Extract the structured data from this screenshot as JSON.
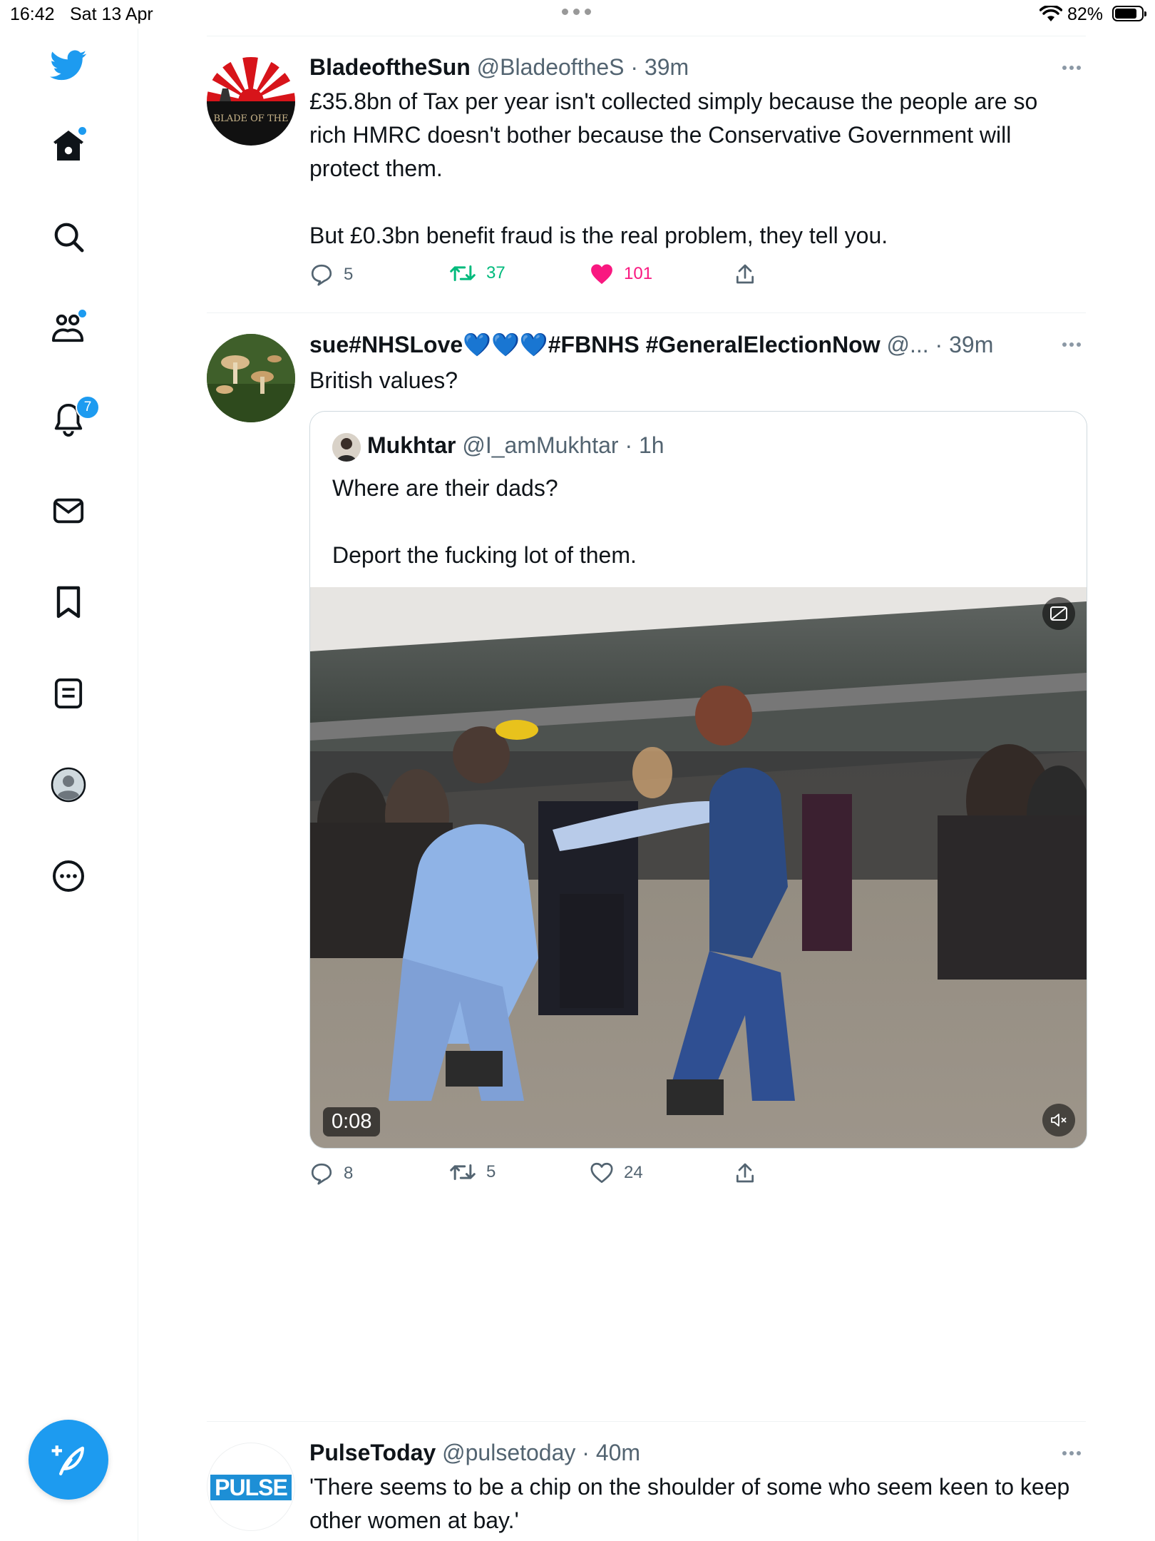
{
  "status_bar": {
    "time": "16:42",
    "date": "Sat 13 Apr",
    "battery": "82%"
  },
  "nav": {
    "items": [
      {
        "name": "home",
        "icon": "home-icon"
      },
      {
        "name": "explore",
        "icon": "search-icon"
      },
      {
        "name": "communities",
        "icon": "communities-icon"
      },
      {
        "name": "notifications",
        "icon": "bell-icon",
        "badge": "7"
      },
      {
        "name": "messages",
        "icon": "envelope-icon"
      },
      {
        "name": "bookmarks",
        "icon": "bookmark-icon"
      },
      {
        "name": "lists",
        "icon": "list-icon"
      },
      {
        "name": "profile",
        "icon": "profile-icon"
      },
      {
        "name": "more",
        "icon": "more-circle-icon"
      }
    ],
    "accent": "#1d9bf0"
  },
  "tweets": [
    {
      "name": "BladeoftheSun",
      "handle": "@BladeoftheS",
      "time": "39m",
      "text": "£35.8bn of Tax per year isn't collected simply because the people are so rich HMRC doesn't bother because the Conservative Government will protect them.\n\nBut £0.3bn benefit fraud is the real problem, they tell you.",
      "replies": "5",
      "retweets": "37",
      "likes": "101",
      "avatar_text": "BLADE OF THE"
    },
    {
      "name": "sue#NHSLove💙💙💙#FBNHS #GeneralElectionNow",
      "handle": "@...",
      "time": "39m",
      "text": "British values?",
      "replies": "8",
      "retweets": "5",
      "likes": "24",
      "quote": {
        "name": "Mukhtar",
        "handle": "@I_amMukhtar",
        "time": "1h",
        "text": "Where are their dads?\n\nDeport the fucking lot of them.",
        "video_duration": "0:08"
      }
    },
    {
      "name": "PulseToday",
      "handle": "@pulsetoday",
      "time": "40m",
      "text": "'There seems to be a chip on the shoulder of some who seem keen to keep other women at bay.'",
      "avatar_text": "PULSE"
    }
  ]
}
